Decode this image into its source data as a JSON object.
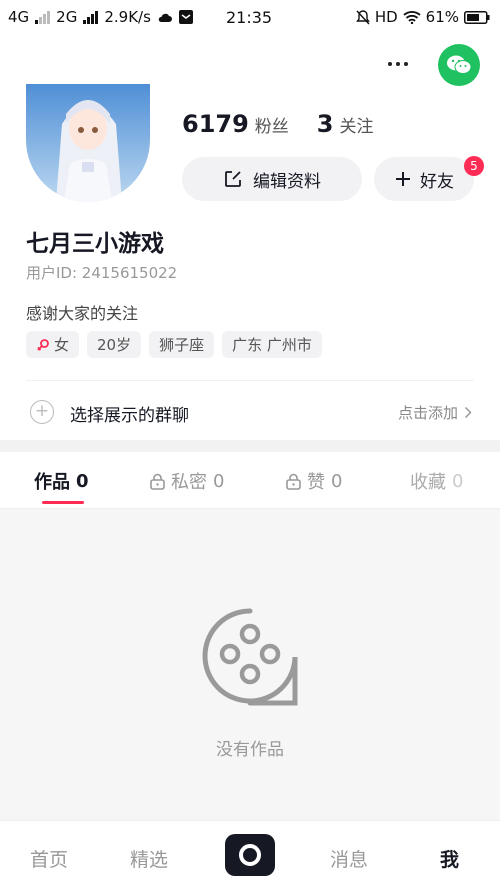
{
  "status_bar": {
    "network1": "4G",
    "network2": "2G",
    "speed": "2.9K/s",
    "time": "21:35",
    "hd": "HD",
    "battery": "61%"
  },
  "profile": {
    "followers_count": "6179",
    "followers_label": "粉丝",
    "following_count": "3",
    "following_label": "关注",
    "edit_label": "编辑资料",
    "friend_label": "好友",
    "friend_badge": "5",
    "name": "七月三小游戏",
    "user_id": "用户ID: 2415615022",
    "bio": "感谢大家的关注",
    "tags": [
      "女",
      "20岁",
      "狮子座",
      "广东 广州市"
    ]
  },
  "group_row": {
    "label": "选择展示的群聊",
    "action": "点击添加"
  },
  "tabs": [
    {
      "label": "作品",
      "count": "0"
    },
    {
      "label": "私密",
      "count": "0"
    },
    {
      "label": "赞",
      "count": "0"
    },
    {
      "label": "收藏",
      "count": "0"
    }
  ],
  "empty": {
    "text": "没有作品"
  },
  "bottom_nav": {
    "home": "首页",
    "featured": "精选",
    "messages": "消息",
    "me": "我"
  },
  "colors": {
    "accent": "#fe2c55",
    "wechat": "#1fc160",
    "dark": "#161823"
  }
}
